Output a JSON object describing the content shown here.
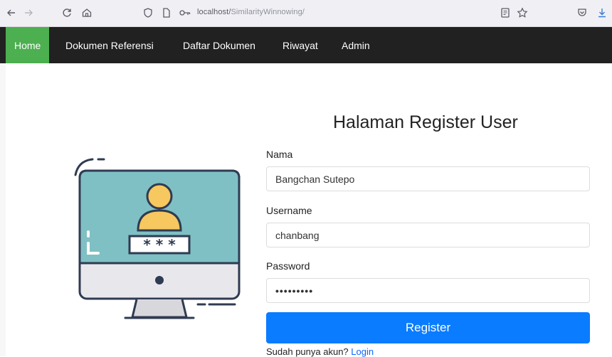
{
  "browser": {
    "url_host": "localhost/",
    "url_path": "SimilarityWinnowing/"
  },
  "nav": {
    "items": [
      {
        "label": "Home"
      },
      {
        "label": "Dokumen Referensi"
      },
      {
        "label": "Daftar Dokumen"
      },
      {
        "label": "Riwayat"
      },
      {
        "label": "Admin"
      }
    ]
  },
  "page": {
    "title": "Halaman Register User"
  },
  "form": {
    "nama_label": "Nama",
    "nama_value": "Bangchan Sutepo",
    "username_label": "Username",
    "username_value": "chanbang",
    "password_label": "Password",
    "password_value": "•••••••••",
    "register_label": "Register",
    "login_prompt": "Sudah punya akun?",
    "login_link": "Login"
  },
  "illustration": {
    "password_mask": "* * *"
  },
  "colors": {
    "navbar": "#212121",
    "active_nav": "#4caf50",
    "primary": "#0a7cff",
    "screen": "#7fc0c4",
    "avatar": "#f6c85f"
  }
}
